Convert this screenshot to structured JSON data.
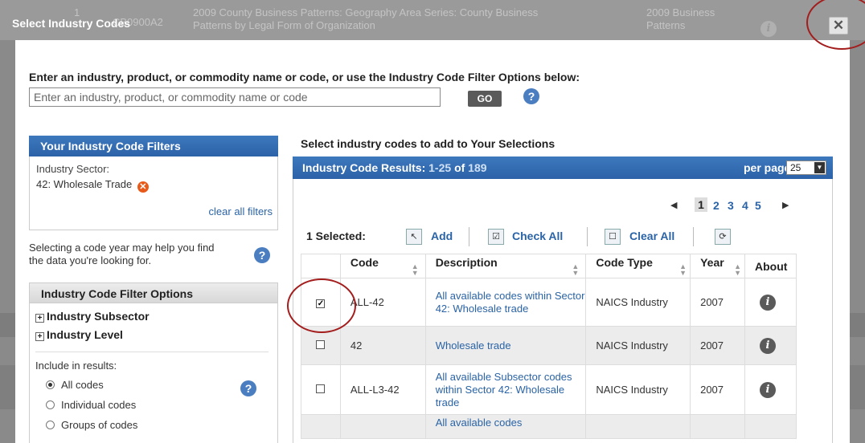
{
  "background": {
    "row_number": "1",
    "dataset_id": "CB0900A2",
    "dataset_title_line1": "2009 County Business Patterns: Geography Area Series: County Business",
    "dataset_title_line2": "Patterns by Legal Form of Organization",
    "program_line1": "2009 Business",
    "program_line2": "Patterns",
    "info_icon": "info-icon"
  },
  "modal": {
    "title": "Select Industry Codes",
    "close_icon": "close-icon",
    "close_glyph": "✕"
  },
  "search": {
    "prompt": "Enter an industry, product, or commodity name or code, or use the Industry Code Filter Options below:",
    "placeholder": "Enter an industry, product, or commodity name or code",
    "value": "",
    "go_label": "GO",
    "help_glyph": "?"
  },
  "filters_panel": {
    "title": "Your Industry Code Filters",
    "sector_label": "Industry Sector:",
    "sector_value": "42: Wholesale Trade",
    "remove_glyph": "✕",
    "clear_all": "clear all filters"
  },
  "year_help": {
    "text": "Selecting a code year may help you find the data you're looking for.",
    "help_glyph": "?"
  },
  "filter_options": {
    "title": "Industry Code Filter Options",
    "expanders": [
      "Industry Subsector",
      "Industry Level"
    ],
    "plus_glyph": "+",
    "include_label": "Include in results:",
    "radios": [
      "All codes",
      "Individual codes",
      "Groups of codes"
    ],
    "selected_radio": "All codes",
    "help_glyph": "?"
  },
  "results": {
    "label": "Select industry codes to add to Your Selections",
    "header_title": "Industry Code Results:",
    "range": "1-25",
    "of_label": "of",
    "total": "189",
    "per_page_label": "per page:",
    "per_page_value": "25",
    "pager": {
      "prev_glyph": "◀",
      "next_glyph": "▶",
      "pages": [
        "1",
        "2",
        "3",
        "4",
        "5"
      ],
      "current": "1"
    },
    "toolbar": {
      "selected_count": "1 Selected:",
      "add": "Add",
      "check_all": "Check All",
      "clear_all": "Clear All"
    },
    "columns": [
      "Code",
      "Description",
      "Code Type",
      "Year",
      "About"
    ],
    "rows": [
      {
        "checked": true,
        "code": "ALL-42",
        "description": "All available codes within Sector 42: Wholesale trade",
        "code_type": "NAICS Industry",
        "year": "2007"
      },
      {
        "checked": false,
        "code": "42",
        "description": "Wholesale trade",
        "code_type": "NAICS Industry",
        "year": "2007"
      },
      {
        "checked": false,
        "code": "ALL-L3-42",
        "description": "All available Subsector codes within Sector 42: Wholesale trade",
        "code_type": "NAICS Industry",
        "year": "2007"
      },
      {
        "checked": false,
        "code": "",
        "description": "All available codes",
        "code_type": "",
        "year": ""
      }
    ],
    "info_glyph": "i"
  },
  "colors": {
    "header_blue": "#2c62a8",
    "link_blue": "#2a63a6",
    "annotation_red": "#a41d1d",
    "remove_orange": "#e85a1a"
  }
}
